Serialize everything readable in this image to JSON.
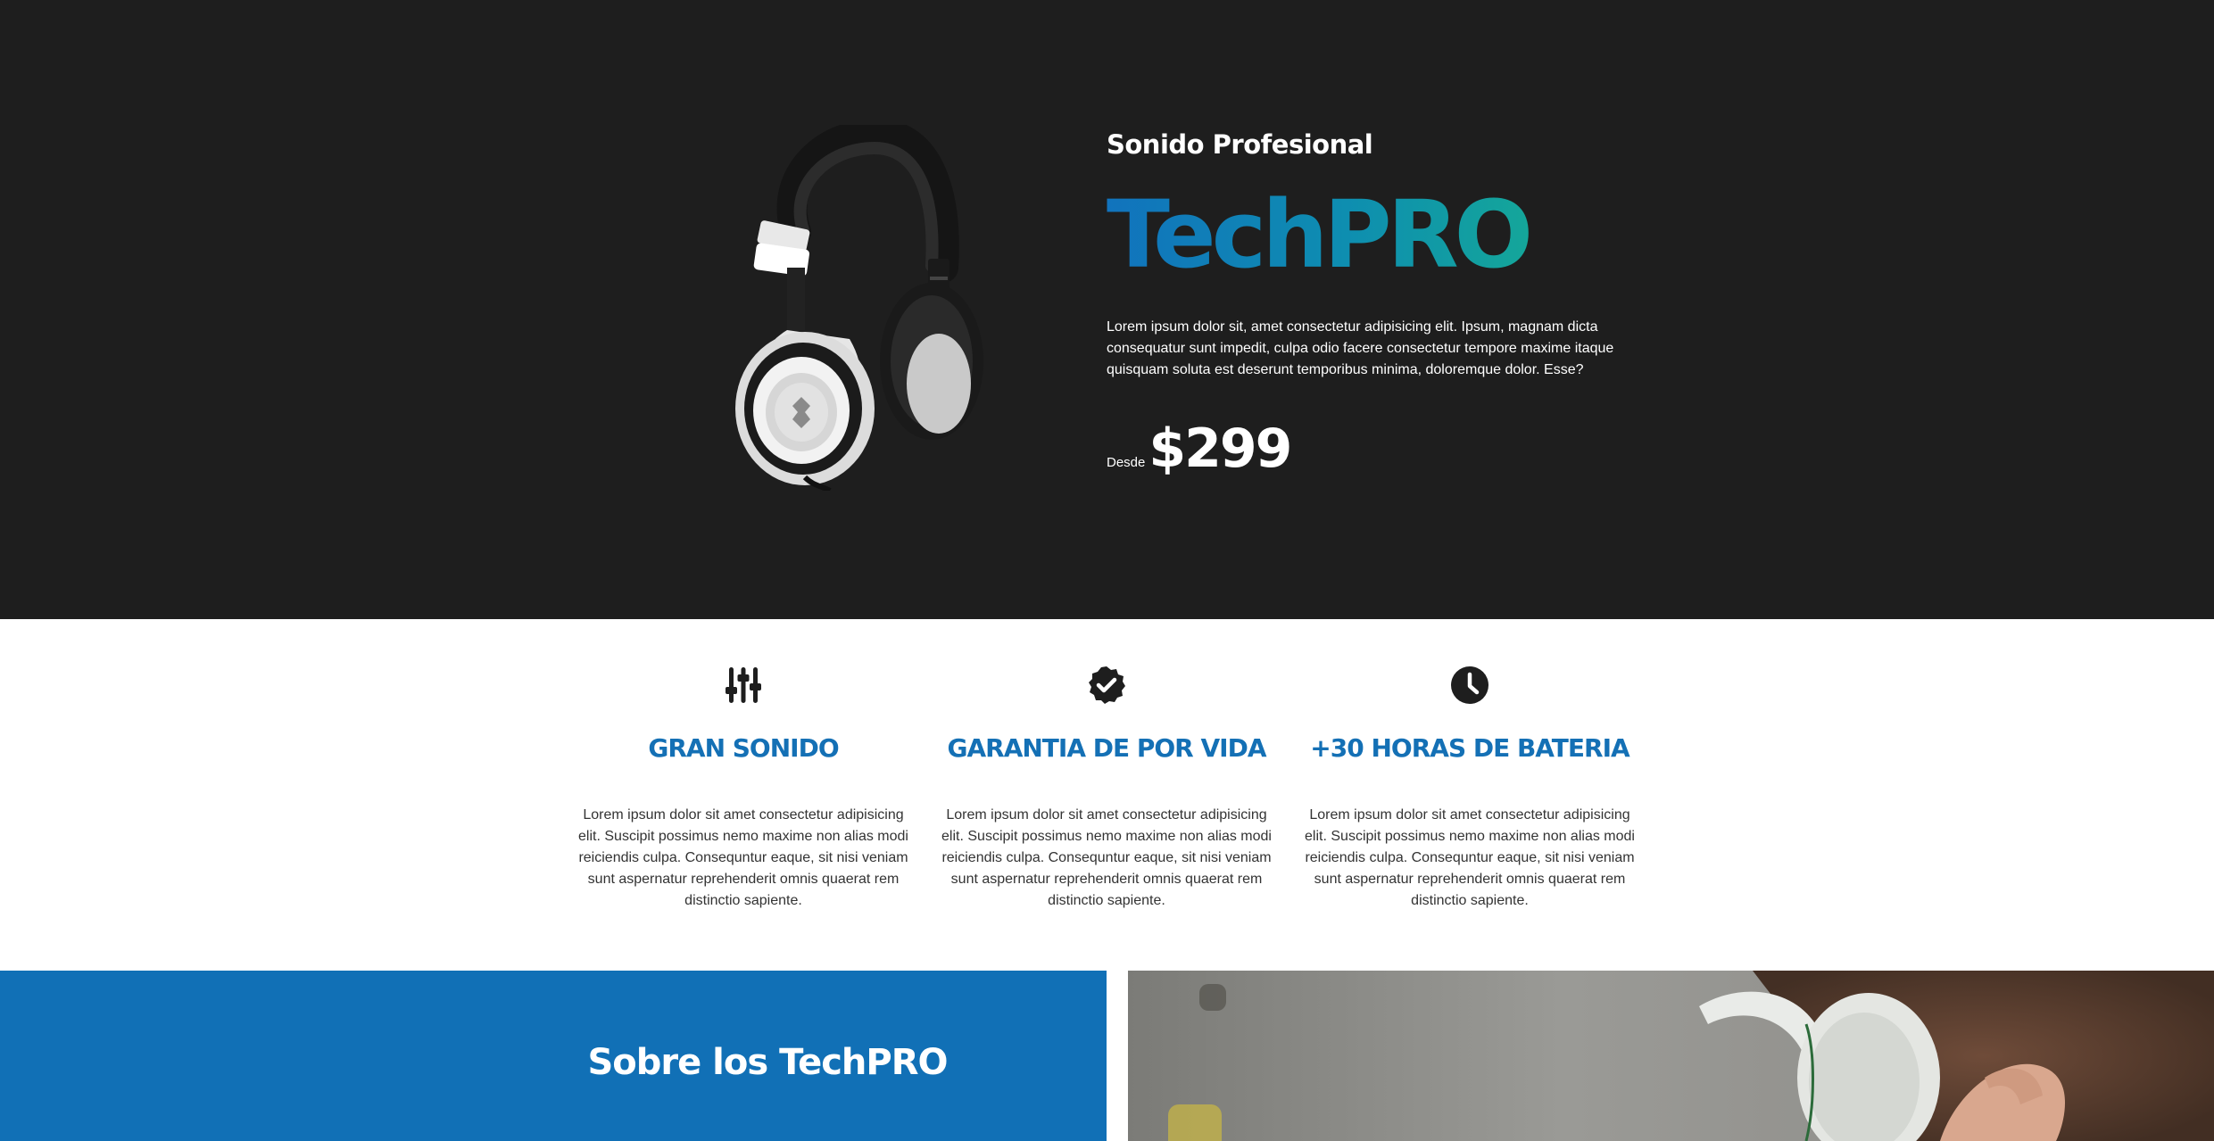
{
  "hero": {
    "subtitle": "Sonido Profesional",
    "brand": "TechPRO",
    "description": "Lorem ipsum dolor sit, amet consectetur adipisicing elit. Ipsum, magnam dicta consequatur sunt impedit, culpa odio facere consectetur tempore maxime itaque quisquam soluta est deserunt temporibus minima, doloremque dolor. Esse?",
    "price_prefix": "Desde",
    "price": "$299",
    "image": "headphones-image"
  },
  "features": [
    {
      "icon": "sliders-icon",
      "title": "GRAN SONIDO",
      "text": "Lorem ipsum dolor sit amet consectetur adipisicing elit. Suscipit possimus nemo maxime non alias modi reiciendis culpa. Consequntur eaque, sit nisi veniam sunt aspernatur reprehenderit omnis quaerat rem distinctio sapiente."
    },
    {
      "icon": "check-badge-icon",
      "title": "GARANTIA DE POR VIDA",
      "text": "Lorem ipsum dolor sit amet consectetur adipisicing elit. Suscipit possimus nemo maxime non alias modi reiciendis culpa. Consequntur eaque, sit nisi veniam sunt aspernatur reprehenderit omnis quaerat rem distinctio sapiente."
    },
    {
      "icon": "clock-icon",
      "title": "+30 HORAS DE BATERIA",
      "text": "Lorem ipsum dolor sit amet consectetur adipisicing elit. Suscipit possimus nemo maxime non alias modi reiciendis culpa. Consequntur eaque, sit nisi veniam sunt aspernatur reprehenderit omnis quaerat rem distinctio sapiente."
    }
  ],
  "about": {
    "title": "Sobre los TechPRO",
    "image": "person-with-headphones-photo"
  },
  "colors": {
    "hero_bg": "#1e1e1e",
    "accent_blue": "#1170b6",
    "gradient_start": "#1173bd",
    "gradient_end": "#18b58c"
  }
}
